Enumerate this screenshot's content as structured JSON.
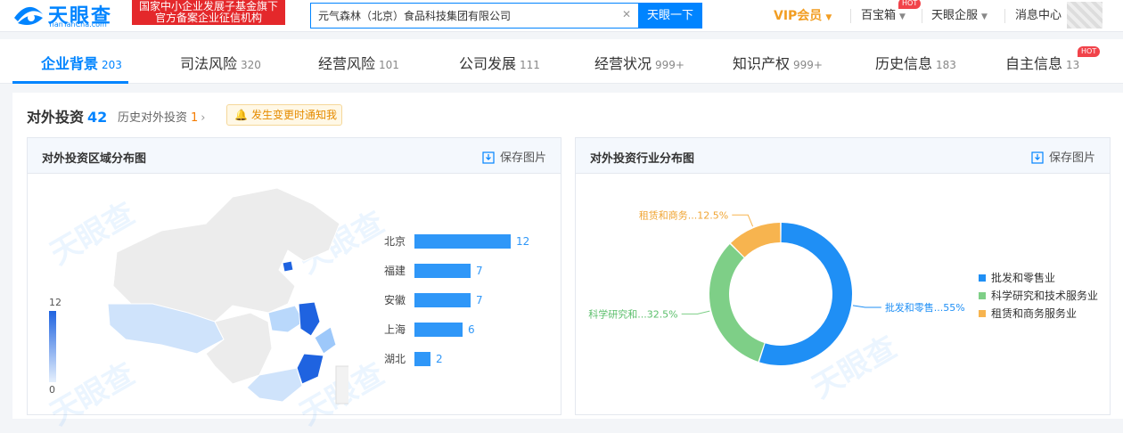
{
  "header": {
    "logo_text": "天眼查",
    "logo_sub": "TianYanCha.com",
    "gov_badge_line1": "国家中小企业发展子基金旗下",
    "gov_badge_line2": "官方备案企业征信机构",
    "search_value": "元气森林（北京）食品科技集团有限公司",
    "search_button": "天眼一下",
    "vip_label": "VIP会员",
    "treasure_label": "百宝箱",
    "treasure_badge": "HOT",
    "enterprise_label": "天眼企服",
    "messages_label": "消息中心"
  },
  "tabs": [
    {
      "label": "企业背景",
      "count": "203",
      "active": true
    },
    {
      "label": "司法风险",
      "count": "320"
    },
    {
      "label": "经营风险",
      "count": "101"
    },
    {
      "label": "公司发展",
      "count": "111"
    },
    {
      "label": "经营状况",
      "count": "999+"
    },
    {
      "label": "知识产权",
      "count": "999+"
    },
    {
      "label": "历史信息",
      "count": "183"
    },
    {
      "label": "自主信息",
      "count": "13",
      "badge": "HOT"
    }
  ],
  "section": {
    "title": "对外投资",
    "count": "42",
    "history_label": "历史对外投资",
    "history_count": "1",
    "notify_label": "发生变更时通知我"
  },
  "region_card": {
    "title": "对外投资区域分布图",
    "save_label": "保存图片",
    "scale_max": "12",
    "scale_min": "0"
  },
  "industry_card": {
    "title": "对外投资行业分布图",
    "save_label": "保存图片"
  },
  "watermark_text": "天眼查",
  "colors": {
    "accent": "#0084ff",
    "bar": "#2f97f8",
    "slice_blue": "#1f8ff5",
    "slice_green": "#7ecf87",
    "slice_orange": "#f7b44f"
  },
  "chart_data": [
    {
      "type": "bar",
      "orientation": "horizontal",
      "categories": [
        "北京",
        "福建",
        "安徽",
        "上海",
        "湖北"
      ],
      "values": [
        12,
        7,
        7,
        6,
        2
      ]
    },
    {
      "type": "pie",
      "style": "donut",
      "slices": [
        {
          "name": "批发和零售业",
          "label": "批发和零售...55%",
          "value": 55
        },
        {
          "name": "科学研究和技术服务业",
          "label": "科学研究和...32.5%",
          "value": 32.5
        },
        {
          "name": "租赁和商务服务业",
          "label": "租赁和商务...12.5%",
          "value": 12.5
        }
      ],
      "legend_position": "right"
    }
  ]
}
